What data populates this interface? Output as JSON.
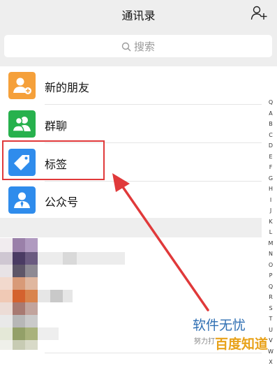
{
  "header": {
    "title": "通讯录",
    "add_icon": "add-friend-icon"
  },
  "search": {
    "placeholder": "搜索",
    "icon": "search-icon"
  },
  "rows": [
    {
      "label": "新的朋友",
      "icon": "new-friend-icon",
      "color": "#f5a03a"
    },
    {
      "label": "群聊",
      "icon": "group-chat-icon",
      "color": "#27b14d"
    },
    {
      "label": "标签",
      "icon": "tag-icon",
      "color": "#2f8cec"
    },
    {
      "label": "公众号",
      "icon": "official-account-icon",
      "color": "#2f8cec"
    }
  ],
  "index_letters": [
    "Q",
    "A",
    "B",
    "C",
    "D",
    "E",
    "F",
    "G",
    "H",
    "I",
    "J",
    "K",
    "L",
    "M",
    "N",
    "O",
    "P",
    "Q",
    "R",
    "S",
    "T",
    "U",
    "V",
    "W",
    "X"
  ],
  "annotation": {
    "highlight_color": "#e0393a"
  },
  "watermark": {
    "title": "软件无忧",
    "subtitle": "努力打",
    "brand": "百度知道"
  }
}
